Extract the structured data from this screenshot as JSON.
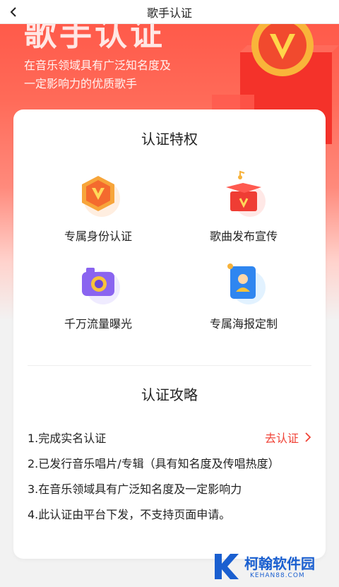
{
  "nav": {
    "title": "歌手认证"
  },
  "hero": {
    "big_title": "歌手认证",
    "description": "在音乐领域具有广泛知名度及一定影响力的优质歌手"
  },
  "perks": {
    "title": "认证特权",
    "items": [
      {
        "label": "专属身份认证",
        "icon": "v-badge-icon"
      },
      {
        "label": "歌曲发布宣传",
        "icon": "gift-box-icon"
      },
      {
        "label": "千万流量曝光",
        "icon": "camera-icon"
      },
      {
        "label": "专属海报定制",
        "icon": "poster-icon"
      }
    ]
  },
  "guide": {
    "title": "认证攻略",
    "steps": [
      "1.完成实名认证",
      "2.已发行音乐唱片/专辑（具有知名度及传唱热度）",
      "3.在音乐领域具有广泛知名度及一定影响力",
      "4.此认证由平台下发，不支持页面申请。"
    ],
    "action_label": "去认证"
  },
  "watermark": {
    "title": "柯翰软件园",
    "subtitle": "KEHAN88.COM"
  },
  "colors": {
    "accent": "#f04236",
    "hero": "#ff5a4a",
    "watermark": "#1a5fd0"
  }
}
